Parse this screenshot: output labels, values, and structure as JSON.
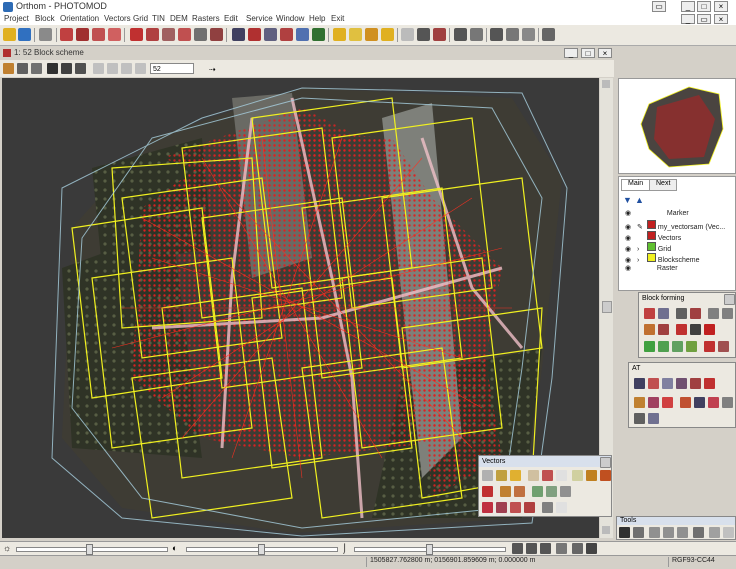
{
  "app": {
    "title": "Orthom - PHOTOMOD"
  },
  "menu": [
    "Project",
    "Block",
    "Orientation",
    "Vectors",
    "Grid",
    "TIN",
    "DEM",
    "Rasters",
    "Edit",
    "Service",
    "Window",
    "Help",
    "Exit"
  ],
  "document": {
    "title": "1: 52 Block scheme",
    "zoom_value": "52"
  },
  "layers_panel": {
    "tabs": [
      "Main",
      "Next"
    ],
    "items": [
      "Marker",
      "my_vectorsam (Vec...",
      "Vectors",
      "Grid",
      "Blockscheme",
      "Raster"
    ]
  },
  "panels": {
    "block_forming": {
      "title": "Block forming"
    },
    "at": {
      "title": "AT"
    },
    "vectors": {
      "title": "Vectors"
    },
    "tools": {
      "title": "Tools"
    }
  },
  "status": {
    "coords": "1505827.762800 m; 0156901.859609 m; 0.000000 m",
    "crs": "RGF93-CC44"
  },
  "colors": {
    "footprint": "#f0f020",
    "vectors": "#d01818",
    "background": "#3a3a3a"
  }
}
